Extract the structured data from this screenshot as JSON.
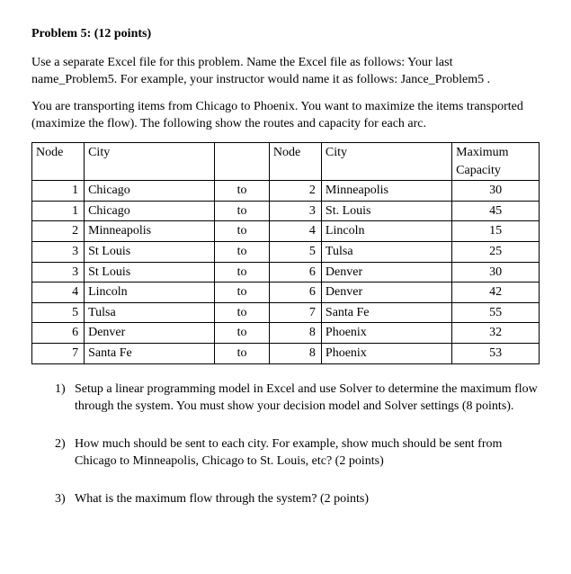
{
  "title": "Problem 5: (12 points)",
  "para1": "Use a separate Excel file for this problem.   Name the Excel file as follows:   Your last name_Problem5.   For example, your instructor would name it as follows: Jance_Problem5 .",
  "para2": "You are transporting items from Chicago to Phoenix.   You want to maximize the items transported (maximize the flow).   The following show the routes and capacity for each arc.",
  "table": {
    "headers": {
      "node_a": "Node",
      "city_a": "City",
      "to": "",
      "node_b": "Node",
      "city_b": "City",
      "cap_line1": "Maximum",
      "cap_line2": "Capacity"
    },
    "rows": [
      {
        "na": "1",
        "ca": "Chicago",
        "to": "to",
        "nb": "2",
        "cb": "Minneapolis",
        "cap": "30"
      },
      {
        "na": "1",
        "ca": "Chicago",
        "to": "to",
        "nb": "3",
        "cb": "St. Louis",
        "cap": "45"
      },
      {
        "na": "2",
        "ca": "Minneapolis",
        "to": "to",
        "nb": "4",
        "cb": "Lincoln",
        "cap": "15"
      },
      {
        "na": "3",
        "ca": "St Louis",
        "to": "to",
        "nb": "5",
        "cb": "Tulsa",
        "cap": "25"
      },
      {
        "na": "3",
        "ca": "St Louis",
        "to": "to",
        "nb": "6",
        "cb": "Denver",
        "cap": "30"
      },
      {
        "na": "4",
        "ca": "Lincoln",
        "to": "to",
        "nb": "6",
        "cb": "Denver",
        "cap": "42"
      },
      {
        "na": "5",
        "ca": "Tulsa",
        "to": "to",
        "nb": "7",
        "cb": "Santa Fe",
        "cap": "55"
      },
      {
        "na": "6",
        "ca": "Denver",
        "to": "to",
        "nb": "8",
        "cb": "Phoenix",
        "cap": "32"
      },
      {
        "na": "7",
        "ca": "Santa Fe",
        "to": "to",
        "nb": "8",
        "cb": "Phoenix",
        "cap": "53"
      }
    ]
  },
  "questions": [
    {
      "num": "1)",
      "text": "Setup a linear programming model in Excel and use Solver to determine the maximum flow through the system. You must show your decision model and Solver settings (8 points)."
    },
    {
      "num": "2)",
      "text": "How much should be sent to each city.  For example, show much should be sent from Chicago to Minneapolis,  Chicago to St. Louis, etc?  (2 points)"
    },
    {
      "num": "3)",
      "text": "What is the maximum flow through the system?  (2 points)"
    }
  ]
}
